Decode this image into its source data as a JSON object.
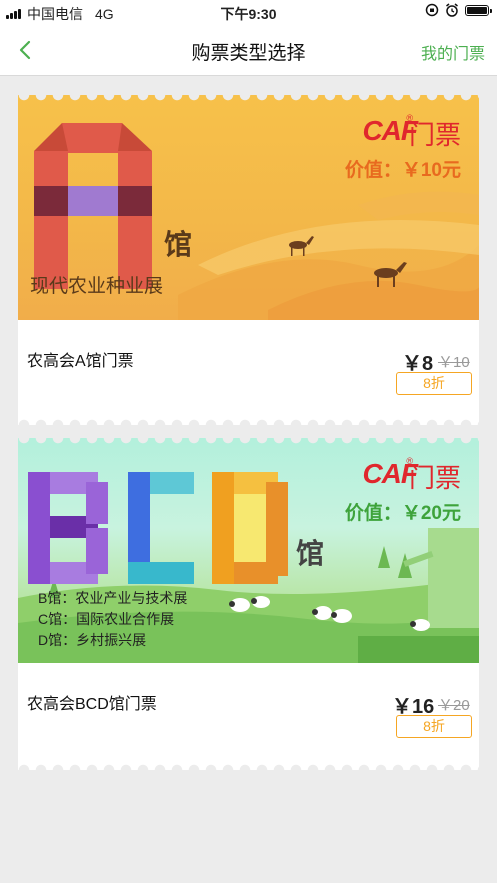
{
  "status_bar": {
    "carrier": "中国电信",
    "network": "4G",
    "time": "下午9:30"
  },
  "nav": {
    "title": "购票类型选择",
    "right_link": "我的门票"
  },
  "tickets": [
    {
      "banner": {
        "logo": "CAF",
        "ticket_word": "门票",
        "value": "价值：￥10元",
        "big_letter": "A",
        "hall_char": "馆",
        "exhibit": "现代农业种业展",
        "colors": {
          "letter": "#e05a4a",
          "bg": "#f5bd48"
        }
      },
      "name": "农高会A馆门票",
      "price": "￥8",
      "original_price": "￥10",
      "discount": "8折"
    },
    {
      "banner": {
        "logo": "CAF",
        "ticket_word": "门票",
        "value": "价值：￥20元",
        "big_letters": [
          "B",
          "C",
          "D"
        ],
        "hall_char": "馆",
        "halls": [
          "B馆：农业产业与技术展",
          "C馆：国际农业合作展",
          "D馆：乡村振兴展"
        ],
        "colors": {
          "b": "#8a4fd0",
          "c": "#38b8cc",
          "d": "#f0a020",
          "bg": "#bff0d8"
        }
      },
      "name": "农高会BCD馆门票",
      "price": "￥16",
      "original_price": "￥20",
      "discount": "8折"
    }
  ]
}
